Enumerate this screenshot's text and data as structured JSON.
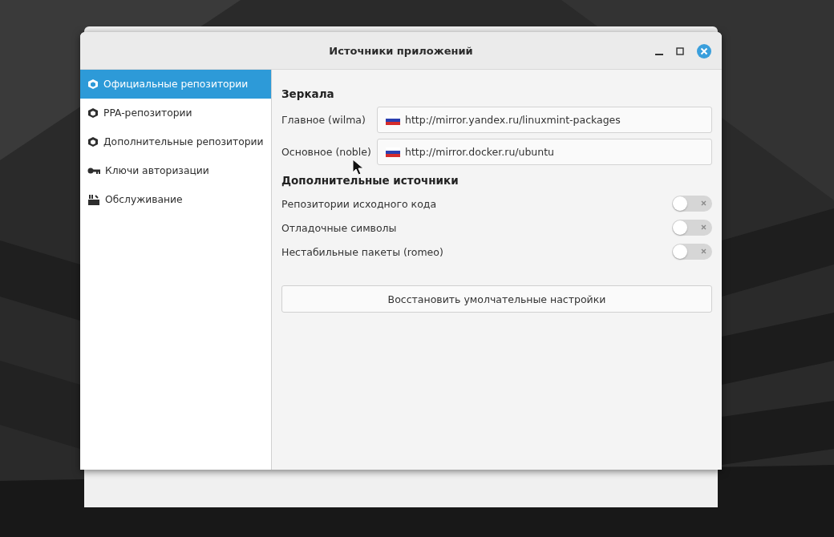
{
  "window": {
    "title": "Источники приложений"
  },
  "sidebar": {
    "items": [
      {
        "label": "Официальные репозитории",
        "selected": true
      },
      {
        "label": "PPA-репозитории",
        "selected": false
      },
      {
        "label": "Дополнительные репозитории",
        "selected": false
      },
      {
        "label": "Ключи авторизации",
        "selected": false
      },
      {
        "label": "Обслуживание",
        "selected": false
      }
    ]
  },
  "mirrors": {
    "heading": "Зеркала",
    "rows": [
      {
        "label": "Главное (wilma)",
        "value": "http://mirror.yandex.ru/linuxmint-packages"
      },
      {
        "label": "Основное (noble)",
        "value": "http://mirror.docker.ru/ubuntu"
      }
    ]
  },
  "sources": {
    "heading": "Дополнительные источники",
    "toggles": [
      {
        "label": "Репозитории исходного кода",
        "on": false
      },
      {
        "label": "Отладочные символы",
        "on": false
      },
      {
        "label": "Нестабильные пакеты (romeo)",
        "on": false
      }
    ]
  },
  "reset_button": "Восстановить умолчательные настройки"
}
